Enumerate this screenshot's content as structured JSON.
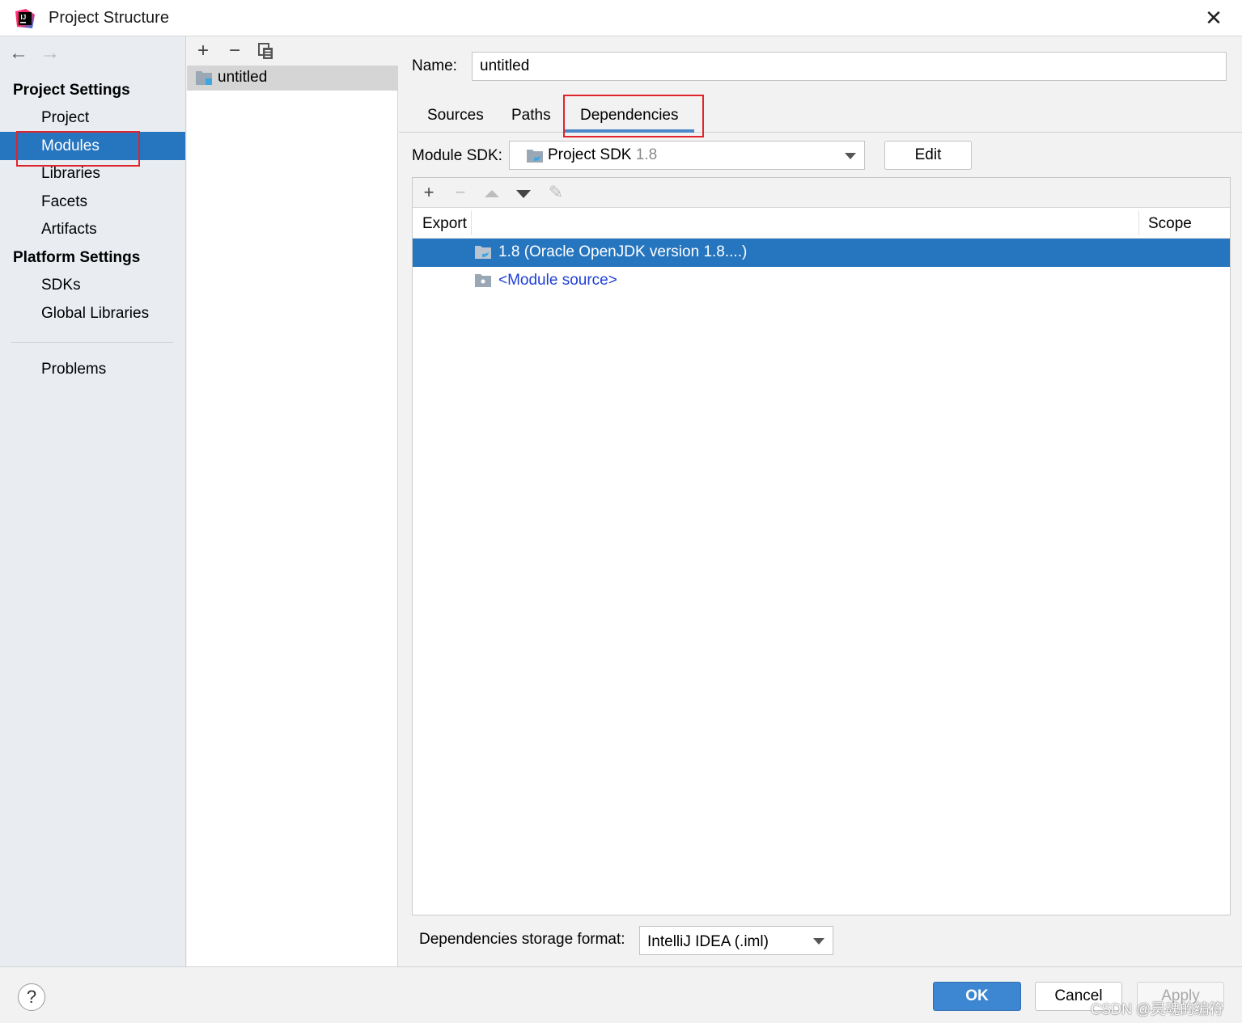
{
  "window": {
    "title": "Project Structure",
    "close_glyph": "✕"
  },
  "sidebar": {
    "back_glyph": "←",
    "forward_glyph": "→",
    "project_settings_heading": "Project Settings",
    "project_settings_items": [
      "Project",
      "Modules",
      "Libraries",
      "Facets",
      "Artifacts"
    ],
    "selected_item": "Modules",
    "platform_settings_heading": "Platform Settings",
    "platform_settings_items": [
      "SDKs",
      "Global Libraries"
    ],
    "problems_label": "Problems"
  },
  "module_list": {
    "add_glyph": "+",
    "remove_glyph": "−",
    "modules": [
      "untitled"
    ]
  },
  "module_panel": {
    "name_label": "Name:",
    "name_value": "untitled",
    "tabs": [
      "Sources",
      "Paths",
      "Dependencies"
    ],
    "active_tab": "Dependencies",
    "sdk_label": "Module SDK:",
    "sdk_name": "Project SDK",
    "sdk_version": "1.8",
    "edit_button": "Edit",
    "toolbar": {
      "add_glyph": "+",
      "remove_glyph": "−",
      "edit_glyph": "✎"
    },
    "columns": {
      "export": "Export",
      "scope": "Scope"
    },
    "dependencies": [
      {
        "label": "1.8 (Oracle OpenJDK version 1.8....)",
        "selected": true
      },
      {
        "label": "<Module source>",
        "selected": false
      }
    ],
    "storage_format_label": "Dependencies storage format:",
    "storage_format_value": "IntelliJ IDEA (.iml)"
  },
  "footer": {
    "help_glyph": "?",
    "ok": "OK",
    "cancel": "Cancel",
    "apply": "Apply",
    "watermark": "CSDN @灵魂的编符"
  },
  "colors": {
    "selection": "#2675bf",
    "highlight_box": "#e0242b",
    "tab_underline": "#4a88c7",
    "link": "#1f3fd6",
    "ok_button": "#3d86d1"
  }
}
